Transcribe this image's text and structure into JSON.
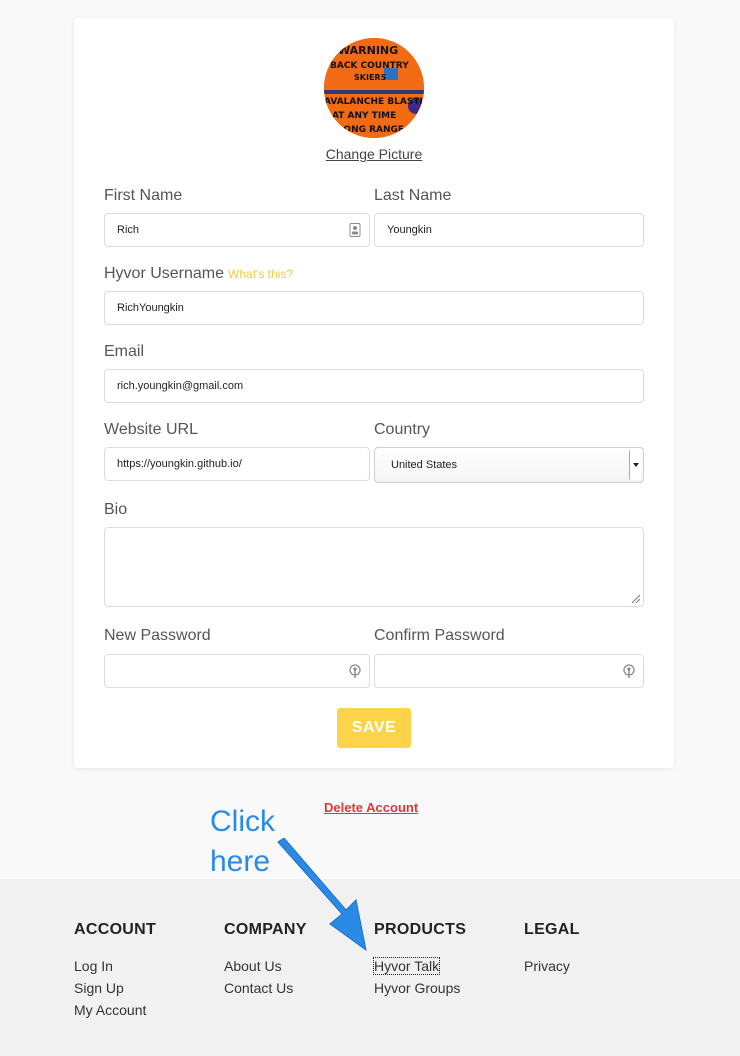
{
  "profile": {
    "avatar_texts": [
      "WARNING",
      "BACK COUNTRY",
      "SKIERS",
      "AVALANCHE BLASTING",
      "AT ANY TIME",
      "LONG RANGE"
    ],
    "change_picture": "Change Picture",
    "first_name_label": "First Name",
    "first_name_value": "Rich",
    "last_name_label": "Last Name",
    "last_name_value": "Youngkin",
    "username_label": "Hyvor Username",
    "username_hint": "What's this?",
    "username_value": "RichYoungkin",
    "email_label": "Email",
    "email_value": "rich.youngkin@gmail.com",
    "website_label": "Website URL",
    "website_value": "https://youngkin.github.io/",
    "country_label": "Country",
    "country_value": "United States",
    "bio_label": "Bio",
    "bio_value": "",
    "new_password_label": "New Password",
    "confirm_password_label": "Confirm Password",
    "save_label": "SAVE",
    "delete_label": "Delete Account"
  },
  "annotation": {
    "line1": "Click",
    "line2": "here",
    "color": "#2a8be6"
  },
  "footer": {
    "account": {
      "heading": "ACCOUNT",
      "links": [
        "Log In",
        "Sign Up",
        "My Account"
      ]
    },
    "company": {
      "heading": "COMPANY",
      "links": [
        "About Us",
        "Contact Us"
      ]
    },
    "products": {
      "heading": "PRODUCTS",
      "links": [
        "Hyvor Talk",
        "Hyvor Groups"
      ]
    },
    "legal": {
      "heading": "LEGAL",
      "links": [
        "Privacy"
      ]
    }
  },
  "colors": {
    "accent": "#fdd34a",
    "danger": "#e0363a",
    "hint": "#f6c94a"
  }
}
